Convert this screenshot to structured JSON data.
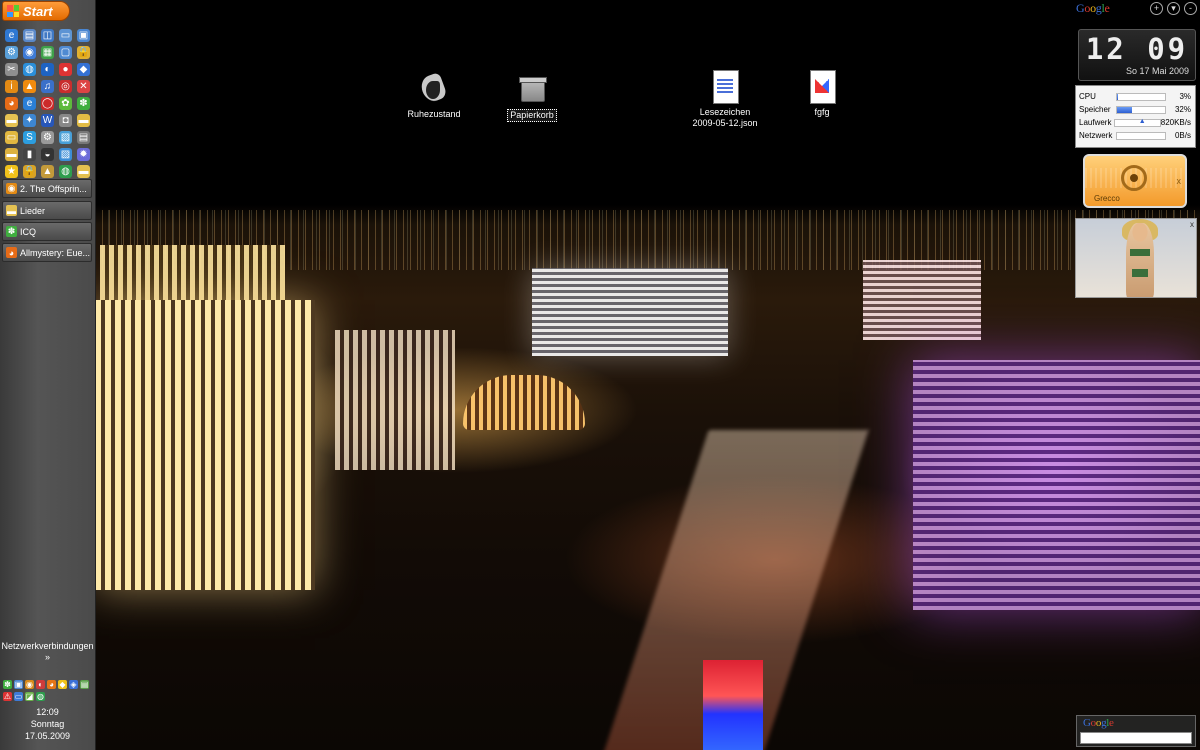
{
  "start_button": {
    "label": "Start"
  },
  "quicklaunch": [
    {
      "icon": "browser-icon",
      "glyph": "e",
      "color": "#2f78d2"
    },
    {
      "icon": "computer-icon",
      "glyph": "▤",
      "color": "#5a88c9"
    },
    {
      "icon": "network-icon",
      "glyph": "◫",
      "color": "#3f79c4"
    },
    {
      "icon": "monitor-icon",
      "glyph": "▭",
      "color": "#5d94d4"
    },
    {
      "icon": "explorer-icon",
      "glyph": "▣",
      "color": "#4a86d1"
    },
    {
      "icon": "settings-icon",
      "glyph": "⚙",
      "color": "#5aa0d9"
    },
    {
      "icon": "chat-icon",
      "glyph": "◉",
      "color": "#3d7ad6"
    },
    {
      "icon": "app-green-icon",
      "glyph": "▦",
      "color": "#3fa14a"
    },
    {
      "icon": "window-icon",
      "glyph": "▢",
      "color": "#4f8ad2"
    },
    {
      "icon": "lock-icon",
      "glyph": "🔒",
      "color": "#e0b032"
    },
    {
      "icon": "tools-icon",
      "glyph": "✂",
      "color": "#8e8e8e"
    },
    {
      "icon": "globe-icon",
      "glyph": "◍",
      "color": "#2b8fd9"
    },
    {
      "icon": "media-icon",
      "glyph": "◐",
      "color": "#1e63c2"
    },
    {
      "icon": "red-app-icon",
      "glyph": "●",
      "color": "#d33"
    },
    {
      "icon": "blue-app-icon",
      "glyph": "◆",
      "color": "#3471d4"
    },
    {
      "icon": "info-icon",
      "glyph": "i",
      "color": "#e38a14"
    },
    {
      "icon": "vlc-icon",
      "glyph": "▲",
      "color": "#f08b0e"
    },
    {
      "icon": "music-icon",
      "glyph": "♫",
      "color": "#3a70c9"
    },
    {
      "icon": "red-circle-icon",
      "glyph": "◎",
      "color": "#c92d2d"
    },
    {
      "icon": "cross-icon",
      "glyph": "✕",
      "color": "#d44"
    },
    {
      "icon": "firefox-icon",
      "glyph": "◕",
      "color": "#e66b17"
    },
    {
      "icon": "ie-icon",
      "glyph": "e",
      "color": "#2a7fd6"
    },
    {
      "icon": "opera-icon",
      "glyph": "◯",
      "color": "#cc2a2a"
    },
    {
      "icon": "flower-icon",
      "glyph": "✿",
      "color": "#5dba3c"
    },
    {
      "icon": "icq-icon",
      "glyph": "✽",
      "color": "#3fae3f"
    },
    {
      "icon": "folder-icon",
      "glyph": "▬",
      "color": "#e5c252"
    },
    {
      "icon": "gear-blue-icon",
      "glyph": "✦",
      "color": "#3d86d1"
    },
    {
      "icon": "word-icon",
      "glyph": "W",
      "color": "#2756b8"
    },
    {
      "icon": "disk-icon",
      "glyph": "◘",
      "color": "#888"
    },
    {
      "icon": "folder-yellow-icon",
      "glyph": "▬",
      "color": "#e2bc44"
    },
    {
      "icon": "folder-open-icon",
      "glyph": "▭",
      "color": "#e1b740"
    },
    {
      "icon": "skype-icon",
      "glyph": "S",
      "color": "#2c9ee0"
    },
    {
      "icon": "gear-gray-icon",
      "glyph": "⚙",
      "color": "#9a9a9a"
    },
    {
      "icon": "picture-icon",
      "glyph": "▧",
      "color": "#48a0d8"
    },
    {
      "icon": "scanner-icon",
      "glyph": "▤",
      "color": "#777"
    },
    {
      "icon": "folder-alt-icon",
      "glyph": "▬",
      "color": "#dcb13f"
    },
    {
      "icon": "terminal-icon",
      "glyph": "▮",
      "color": "#444"
    },
    {
      "icon": "steam-icon",
      "glyph": "◒",
      "color": "#333"
    },
    {
      "icon": "image-icon",
      "glyph": "▨",
      "color": "#3c8dd6"
    },
    {
      "icon": "gear-dark-icon",
      "glyph": "✹",
      "color": "#6c6cd9"
    },
    {
      "icon": "star-icon",
      "glyph": "★",
      "color": "#f1c21b"
    },
    {
      "icon": "lock-alt-icon",
      "glyph": "🔒",
      "color": "#d8a326"
    },
    {
      "icon": "bag-icon",
      "glyph": "▲",
      "color": "#c39a3a"
    },
    {
      "icon": "earth-icon",
      "glyph": "◍",
      "color": "#2e9d4d"
    },
    {
      "icon": "folder-b-icon",
      "glyph": "▬",
      "color": "#e4c04f"
    }
  ],
  "tasks": [
    {
      "label": "2. The Offsprin...",
      "icon": "media-player-icon",
      "glyph": "◉",
      "color": "#e38a14"
    },
    {
      "label": "Lieder",
      "icon": "folder-icon",
      "glyph": "▬",
      "color": "#e5c252"
    },
    {
      "label": "ICQ",
      "icon": "icq-icon",
      "glyph": "✽",
      "color": "#3fae3f"
    },
    {
      "label": "Allmystery: Eue...",
      "icon": "firefox-icon",
      "glyph": "◕",
      "color": "#e66b17"
    }
  ],
  "network": {
    "label": "Netzwerkverbindungen",
    "chevron": "»"
  },
  "tray": [
    {
      "icon": "icq-tray-icon",
      "glyph": "✽",
      "color": "#3fae3f"
    },
    {
      "icon": "network-tray-icon",
      "glyph": "▣",
      "color": "#4a86d1"
    },
    {
      "icon": "volume-tray-icon",
      "glyph": "◉",
      "color": "#d88a1a"
    },
    {
      "icon": "security-tray-icon",
      "glyph": "◐",
      "color": "#cf3b3b"
    },
    {
      "icon": "avast-tray-icon",
      "glyph": "◕",
      "color": "#e67617"
    },
    {
      "icon": "shield-tray-icon",
      "glyph": "◆",
      "color": "#f1c21b"
    },
    {
      "icon": "bluetooth-tray-icon",
      "glyph": "◈",
      "color": "#3b6fd8"
    },
    {
      "icon": "usb-tray-icon",
      "glyph": "▤",
      "color": "#5aa04a"
    },
    {
      "icon": "warning-tray-icon",
      "glyph": "⚠",
      "color": "#d33"
    },
    {
      "icon": "display-tray-icon",
      "glyph": "▭",
      "color": "#3d7ad6"
    },
    {
      "icon": "nvidia-tray-icon",
      "glyph": "◪",
      "color": "#6ab04a"
    },
    {
      "icon": "update-tray-icon",
      "glyph": "◍",
      "color": "#2e9d4d"
    }
  ],
  "tray_clock": {
    "time": "12:09",
    "day": "Sonntag",
    "date": "17.05.2009"
  },
  "desktop_icons": [
    {
      "label": "Ruhezustand"
    },
    {
      "label": "Papierkorb"
    },
    {
      "label_line1": "Lesezeichen",
      "label_line2": "2009-05-12.json"
    },
    {
      "label": "fgfg"
    }
  ],
  "gadgets": {
    "clock": {
      "time": "12 09",
      "date": "So 17 Mai 2009"
    },
    "sysmon": [
      {
        "label": "CPU",
        "value": "3%",
        "level": 0.03
      },
      {
        "label": "Speicher",
        "value": "32%",
        "level": 0.32
      },
      {
        "label": "Laufwerk",
        "value": "820KB/s",
        "level": 0
      },
      {
        "label": "Netzwerk",
        "value": "0B/s",
        "level": 0
      }
    ],
    "media": {
      "name": "Grecco",
      "close": "x"
    },
    "slideshow": {
      "close": "x"
    },
    "google_bar": {
      "add": "+",
      "minimize": "-"
    }
  }
}
